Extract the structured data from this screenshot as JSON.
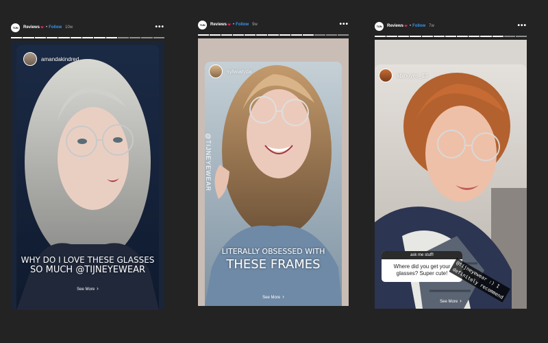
{
  "cards": [
    {
      "account": "Reviews",
      "avatar_text": "TIJN",
      "follow": "Follow",
      "age": "10w",
      "username": "amandakindred",
      "caption_lines": [
        "WHY DO I LOVE THESE GLASSES",
        "SO MUCH @TIJNEYEWEAR"
      ],
      "see_more": "See More"
    },
    {
      "account": "Reviews",
      "avatar_text": "TIJN",
      "follow": "Follow",
      "age": "9w",
      "username": "sylwialyda",
      "vertical_text": "@TIJNEYEWEAR",
      "caption_lines": [
        "LITERALLY OBSESSED WITH",
        "THESE FRAMES"
      ],
      "see_more": "See More"
    },
    {
      "account": "Reviews",
      "avatar_text": "TIJN",
      "follow": "Follow",
      "age": "7w",
      "username": "abinoyes_13",
      "question_title": "ask me stuff!",
      "question_text": "Where did you get your glasses? Super cute!",
      "answer_lines": [
        "@tijneyewear :) I",
        "definitely recommend"
      ],
      "see_more": "See More"
    }
  ],
  "colors": {
    "background": "#232323",
    "follow": "#3897f0",
    "heart": "#e0245e"
  }
}
